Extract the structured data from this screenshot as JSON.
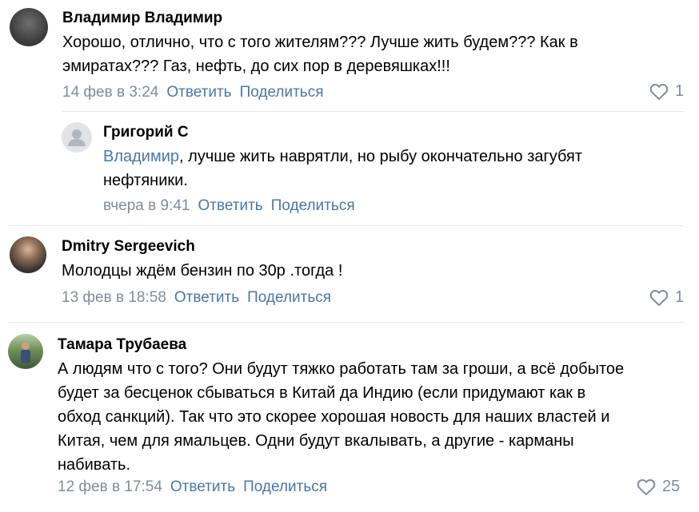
{
  "comments": [
    {
      "author": "Владимир Владимир",
      "text_lines": [
        "Хорошо, отлично, что с того жителям??? Лучше жить будем??? Как в",
        "эмиратах??? Газ, нефть, до сих пор в деревяшках!!!"
      ],
      "date": "14 фев в 3:24",
      "reply_label": "Ответить",
      "share_label": "Поделиться",
      "likes": "1"
    },
    {
      "author": "Григорий С",
      "mention": "Владимир",
      "text_lines": [
        ", лучше жить наврятли, но рыбу окончательно загубят",
        "нефтяники."
      ],
      "date": "вчера в 9:41",
      "reply_label": "Ответить",
      "share_label": "Поделиться"
    },
    {
      "author": "Dmitry Sergeevich",
      "text_lines": [
        "Молодцы ждём бензин по 30р .тогда !"
      ],
      "date": "13 фев в 18:58",
      "reply_label": "Ответить",
      "share_label": "Поделиться",
      "likes": "1"
    },
    {
      "author": "Тамара Трубаева",
      "text_lines": [
        "А людям что с того? Они будут тяжко работать там за гроши, а всё добытое",
        "будет за бесценок сбываться в Китай да Индию (если придумают как в",
        "обход санкций). Так что это скорее хорошая новость для наших властей и",
        "Китая, чем для ямальцев. Одни будут вкалывать, а другие - карманы",
        "набивать."
      ],
      "date": "12 фев в 17:54",
      "reply_label": "Ответить",
      "share_label": "Поделиться",
      "likes": "25"
    }
  ],
  "colors": {
    "link": "#4a76a8",
    "meta": "#818c99",
    "divider": "#e7e8ec"
  },
  "icons": {
    "like": "heart-icon",
    "placeholder_avatar": "user-silhouette-icon"
  }
}
